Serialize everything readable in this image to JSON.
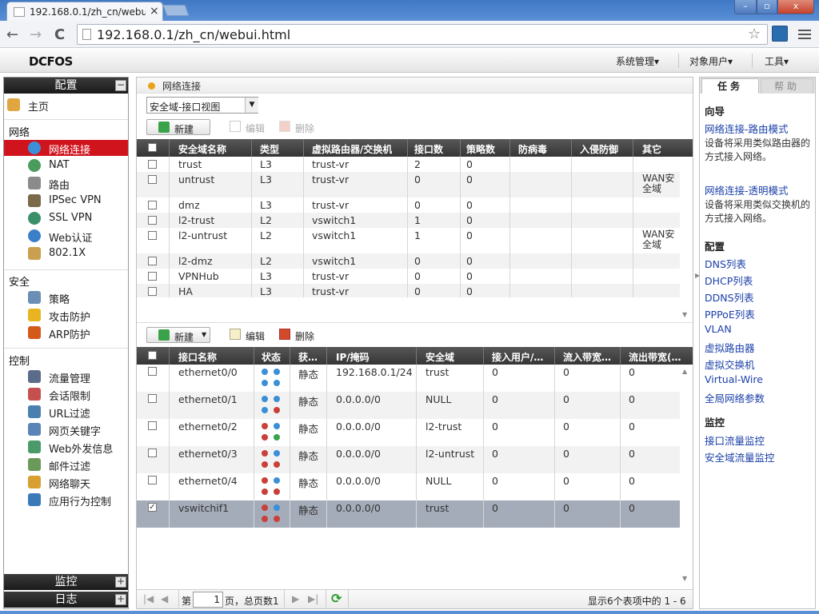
{
  "browser": {
    "tab_title": "192.168.0.1/zh_cn/webui.html",
    "tab_close": "×",
    "url": "192.168.0.1/zh_cn/webui.html",
    "star": "☆",
    "back": "←",
    "forward": "→",
    "reload": "C",
    "min": "–",
    "max": "▫",
    "close": "x"
  },
  "header": {
    "logo": "DCFOS",
    "menus": [
      "系统管理▾",
      "对象用户▾",
      "工具▾"
    ]
  },
  "sidebar": {
    "config_title": "配置",
    "collapse": "−",
    "home": "主页",
    "groups": {
      "network": "网络",
      "security": "安全",
      "control": "控制"
    },
    "network_items": [
      "网络连接",
      "NAT",
      "路由",
      "IPSec VPN",
      "SSL VPN",
      "Web认证",
      "802.1X"
    ],
    "security_items": [
      "策略",
      "攻击防护",
      "ARP防护"
    ],
    "control_items": [
      "流量管理",
      "会话限制",
      "URL过滤",
      "网页关键字",
      "Web外发信息",
      "邮件过滤",
      "网络聊天",
      "应用行为控制"
    ],
    "monitor_title": "监控",
    "log_title": "日志",
    "expand": "+"
  },
  "main": {
    "breadcrumb": "网络连接",
    "view_select": "安全域-接口视图",
    "select_arrow": "▼",
    "top_toolbar": {
      "new": "新建",
      "edit": "编辑",
      "delete": "删除"
    },
    "zone_headers": [
      "安全域名称",
      "类型",
      "虚拟路由器/交换机",
      "接口数",
      "策略数",
      "防病毒",
      "入侵防御",
      "其它"
    ],
    "zones": [
      {
        "name": "trust",
        "type": "L3",
        "vr": "trust-vr",
        "ifs": "2",
        "policies": "0",
        "other": ""
      },
      {
        "name": "untrust",
        "type": "L3",
        "vr": "trust-vr",
        "ifs": "0",
        "policies": "0",
        "other": "WAN安全域"
      },
      {
        "name": "dmz",
        "type": "L3",
        "vr": "trust-vr",
        "ifs": "0",
        "policies": "0",
        "other": ""
      },
      {
        "name": "l2-trust",
        "type": "L2",
        "vr": "vswitch1",
        "ifs": "1",
        "policies": "0",
        "other": ""
      },
      {
        "name": "l2-untrust",
        "type": "L2",
        "vr": "vswitch1",
        "ifs": "1",
        "policies": "0",
        "other": "WAN安全域"
      },
      {
        "name": "l2-dmz",
        "type": "L2",
        "vr": "vswitch1",
        "ifs": "0",
        "policies": "0",
        "other": ""
      },
      {
        "name": "VPNHub",
        "type": "L3",
        "vr": "trust-vr",
        "ifs": "0",
        "policies": "0",
        "other": ""
      },
      {
        "name": "HA",
        "type": "L3",
        "vr": "trust-vr",
        "ifs": "0",
        "policies": "0",
        "other": ""
      }
    ],
    "bottom_toolbar": {
      "new": "新建",
      "edit": "编辑",
      "delete": "删除"
    },
    "if_headers": [
      "接口名称",
      "状态",
      "获…",
      "IP/掩码",
      "安全域",
      "接入用户/…",
      "流入带宽…",
      "流出带宽(…"
    ],
    "interfaces": [
      {
        "name": "ethernet0/0",
        "mode": "静态",
        "ip": "192.168.0.1/24",
        "zone": "trust",
        "users": "0",
        "in": "0",
        "out": "0",
        "checked": false
      },
      {
        "name": "ethernet0/1",
        "mode": "静态",
        "ip": "0.0.0.0/0",
        "zone": "NULL",
        "users": "0",
        "in": "0",
        "out": "0",
        "checked": false
      },
      {
        "name": "ethernet0/2",
        "mode": "静态",
        "ip": "0.0.0.0/0",
        "zone": "l2-trust",
        "users": "0",
        "in": "0",
        "out": "0",
        "checked": false
      },
      {
        "name": "ethernet0/3",
        "mode": "静态",
        "ip": "0.0.0.0/0",
        "zone": "l2-untrust",
        "users": "0",
        "in": "0",
        "out": "0",
        "checked": false
      },
      {
        "name": "ethernet0/4",
        "mode": "静态",
        "ip": "0.0.0.0/0",
        "zone": "NULL",
        "users": "0",
        "in": "0",
        "out": "0",
        "checked": false
      },
      {
        "name": "vswitchif1",
        "mode": "静态",
        "ip": "0.0.0.0/0",
        "zone": "trust",
        "users": "0",
        "in": "0",
        "out": "0",
        "checked": true
      }
    ],
    "pager": {
      "first": "|◀",
      "prev": "◀",
      "page_label": "第",
      "page_value": "1",
      "page_total": "页，总页数1",
      "next": "▶",
      "last": "▶|",
      "refresh": "⟳",
      "summary": "显示6个表项中的 1 - 6"
    }
  },
  "right": {
    "tab_task": "任务",
    "tab_help": "帮助",
    "wizard_title": "向导",
    "route_mode_link": "网络连接-路由模式",
    "route_mode_desc": "设备将采用类似路由器的方式接入网络。",
    "transparent_link": "网络连接-透明模式",
    "transparent_desc": "设备将采用类似交换机的方式接入网络。",
    "config_title": "配置",
    "config_links": [
      "DNS列表",
      "DHCP列表",
      "DDNS列表",
      "PPPoE列表",
      "VLAN",
      "虚拟路由器",
      "虚拟交换机",
      "Virtual-Wire",
      "全局网络参数"
    ],
    "monitor_title": "监控",
    "monitor_links": [
      "接口流量监控",
      "安全域流量监控"
    ]
  },
  "colors": {
    "selected_nav": "#d0141e",
    "header_dark": "#2a2a2a",
    "link": "#1a3fa8",
    "selected_row": "#a5acb9"
  }
}
